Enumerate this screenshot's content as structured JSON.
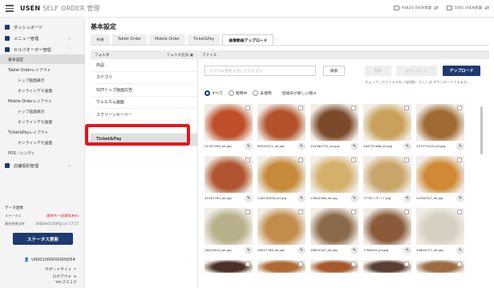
{
  "header": {
    "brand": "USEN",
    "brand_sub": "SELF ORDER 管理",
    "store_1": "A4820 USEN本舗",
    "store_2": "5001 USEN本舗"
  },
  "sidebar": {
    "items": [
      {
        "label": "ダッシュボード"
      },
      {
        "label": "メニュー管理"
      },
      {
        "label": "セルフオーダー管理"
      }
    ],
    "sub_items": [
      {
        "label": "基本設定"
      },
      {
        "label": "Tablet Orderレイアウト"
      },
      {
        "label": "トップ画面表示"
      },
      {
        "label": "オンラインデモ画面"
      },
      {
        "label": "Mobile Orderレイアウト"
      },
      {
        "label": "トップ画面表示"
      },
      {
        "label": "オンラインデモ画面"
      },
      {
        "label": "Ticket&Payレイアウト"
      },
      {
        "label": "オンラインデモ画面"
      },
      {
        "label": "POS／ハンディ"
      }
    ],
    "shop_mgmt": "店舗個別管理",
    "data_label": "データ連携",
    "status_key": "ステータス",
    "status_value": "通常中(一部通常済み)",
    "last_key": "最終連携日時",
    "last_value": "2026年01月06日(火) 17:17",
    "status_button": "ステータス更新",
    "user_id": "U0001000000000054",
    "support": "サポートサイト",
    "logout": "ログアウト",
    "version": "Ver.2.0.1.0"
  },
  "main": {
    "title": "基本設定",
    "tabs": [
      {
        "label": "共通"
      },
      {
        "label": "Tablet Order"
      },
      {
        "label": "Mobile Order"
      },
      {
        "label": "Ticket&Pay"
      },
      {
        "label": "画像動画アップロード"
      }
    ],
    "folder_header": "フォルダ",
    "folder_add": "フォルダ追加",
    "folders": [
      {
        "label": "商品"
      },
      {
        "label": "カテゴリ"
      },
      {
        "label": "SOTトップ画面広告"
      },
      {
        "label": "ウェルカム画面"
      },
      {
        "label": "スクリーンセーバー"
      },
      {
        "label": ""
      },
      {
        "label": "Ticket&Pay"
      }
    ],
    "file_header": "ファイル",
    "search_placeholder": "ファイル名を入力してください",
    "search_button": "検索",
    "delete_button": "削除",
    "download_button": "ダウンロード",
    "upload_button": "アップロード",
    "hint": "チェックしたファイルを一括削除、もしくは ダウンロードできます。",
    "filters": [
      {
        "label": "すべて"
      },
      {
        "label": "使用中"
      },
      {
        "label": "未使用"
      }
    ],
    "sort": "登録日が新しい順",
    "files": [
      {
        "name": "21187590_lel.jpg",
        "color": "#c0502a"
      },
      {
        "name": "89343221_lel.jpg",
        "color": "#b4522b"
      },
      {
        "name": "254360732_lel.jpg",
        "color": "#7b4a2a"
      },
      {
        "name": "284731466_lel.jpg",
        "color": "#caa15a"
      },
      {
        "name": "257375425_lel.jpg",
        "color": "#a06a33"
      },
      {
        "name": "31591763_lel.jpg",
        "color": "#b0552f"
      },
      {
        "name": "226210559_lel.jpg",
        "color": "#c68a3a"
      },
      {
        "name": "13842566_lel.jpg",
        "color": "#d4b06a"
      },
      {
        "name": "ペペロンチーノ.jpg",
        "color": "#c9a56a"
      },
      {
        "name": "42504357_lel.jpg",
        "color": "#d08a35"
      },
      {
        "name": "28425815_lel.jpg",
        "color": "#b7b08a"
      },
      {
        "name": "26937788_lel.jpg",
        "color": "#c28d4a"
      },
      {
        "name": "28655507_lel.jpg",
        "color": "#8b6a4c"
      },
      {
        "name": "7764952_lel.jpg",
        "color": "#8a5a3a"
      },
      {
        "name": "44604277_lel.jpg",
        "color": "#d6cfc2"
      },
      {
        "name": "",
        "color": "#4a3025"
      },
      {
        "name": "",
        "color": "#b06b34"
      },
      {
        "name": "",
        "color": "#a65a2c"
      },
      {
        "name": "",
        "color": "#5a3f33"
      },
      {
        "name": "",
        "color": "#9a6c44"
      }
    ]
  }
}
